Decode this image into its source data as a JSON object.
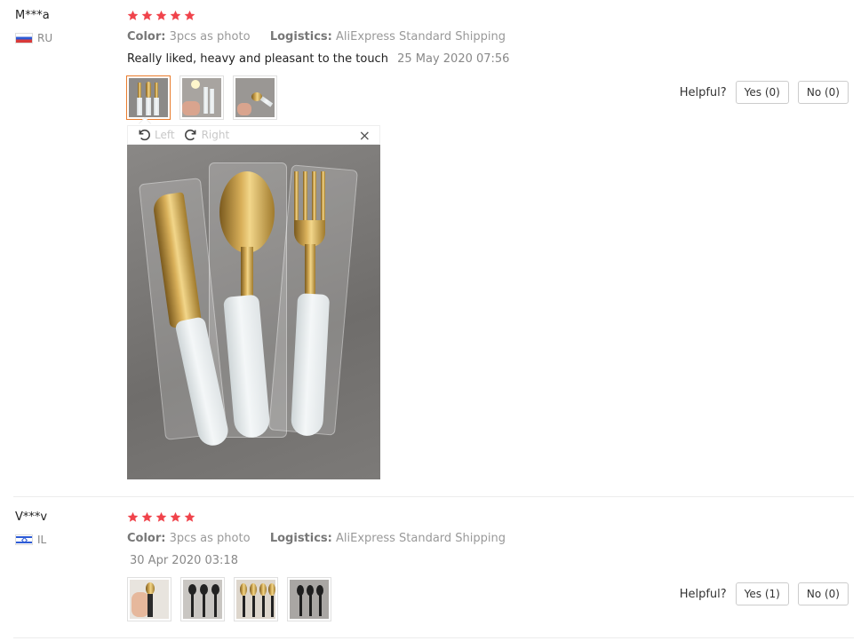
{
  "reviews": [
    {
      "user": "M***a",
      "country": "RU",
      "rating": 5,
      "color_label": "Color:",
      "color_value": "3pcs as photo",
      "logistics_label": "Logistics:",
      "logistics_value": "AliExpress Standard Shipping",
      "text": "Really liked, heavy and pleasant to the touch",
      "date": "25 May 2020 07:56",
      "helpful_label": "Helpful?",
      "yes_label": "Yes (0)",
      "no_label": "No (0)"
    },
    {
      "user": "V***v",
      "country": "IL",
      "rating": 5,
      "color_label": "Color:",
      "color_value": "3pcs as photo",
      "logistics_label": "Logistics:",
      "logistics_value": "AliExpress Standard Shipping",
      "text": "",
      "date": "30 Apr 2020 03:18",
      "helpful_label": "Helpful?",
      "yes_label": "Yes (1)",
      "no_label": "No (0)"
    }
  ],
  "viewer": {
    "rotate_left_label": "Left",
    "rotate_right_label": "Right",
    "close_icon": "×"
  },
  "colors": {
    "star": "#f0434b",
    "active_thumb_border": "#e97c2d"
  }
}
